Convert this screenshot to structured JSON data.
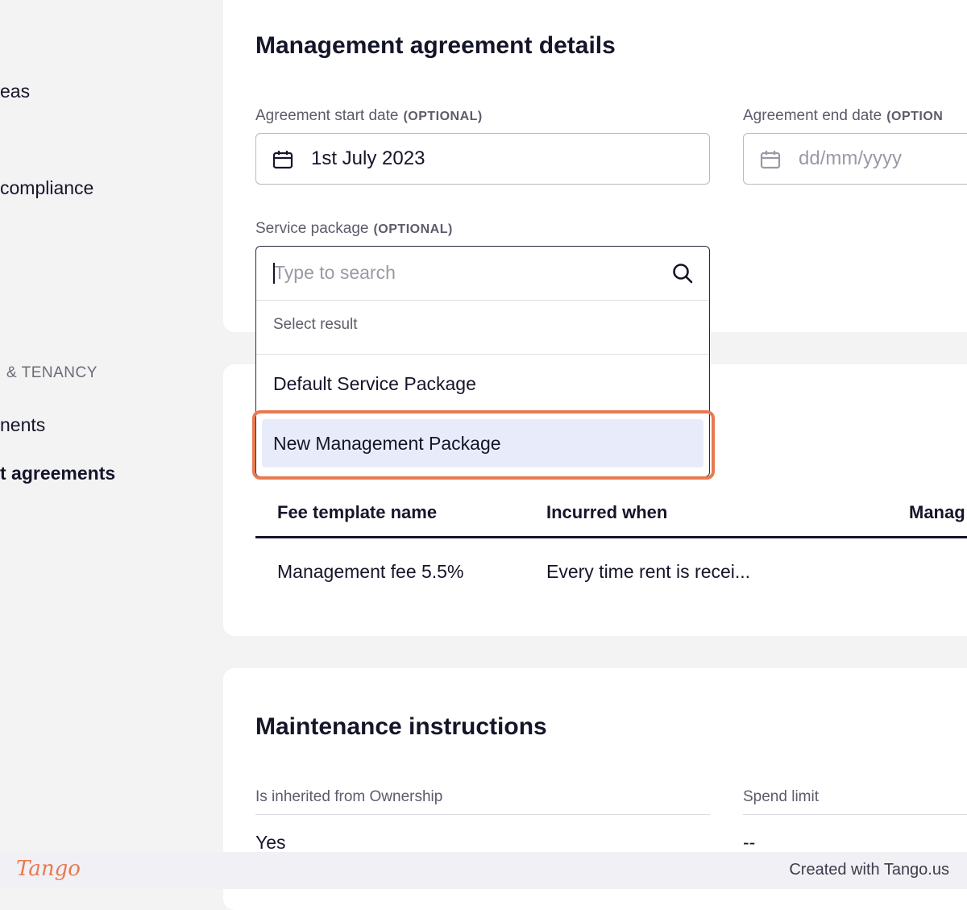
{
  "sidebar": {
    "items": [
      {
        "label": "eas"
      },
      {
        "label": "compliance"
      },
      {
        "label": "nents"
      },
      {
        "label": "t agreements"
      }
    ],
    "section_label": "& TENANCY"
  },
  "management_card": {
    "title": "Management agreement details",
    "start_date": {
      "label": "Agreement start date",
      "optional": "(OPTIONAL)",
      "value": "1st July 2023"
    },
    "end_date": {
      "label": "Agreement end date",
      "optional": "(OPTION",
      "placeholder": "dd/mm/yyyy"
    },
    "service_package": {
      "label": "Service package",
      "optional": "(OPTIONAL)"
    }
  },
  "dropdown": {
    "search_placeholder": "Type to search",
    "hint": "Select result",
    "options": [
      {
        "label": "Default Service Package"
      },
      {
        "label": "New Management Package"
      }
    ]
  },
  "fees_table": {
    "headers": [
      "Fee template name",
      "Incurred when",
      "Manag"
    ],
    "rows": [
      [
        "Management fee 5.5%",
        "Every time rent is recei..."
      ]
    ]
  },
  "maintenance": {
    "title": "Maintenance instructions",
    "fields": [
      {
        "label": "Is inherited from Ownership",
        "value": "Yes"
      },
      {
        "label": "Spend limit",
        "value": "--"
      }
    ]
  },
  "footer": {
    "logo": "Tango",
    "credit": "Created with Tango.us"
  },
  "colors": {
    "highlight": "#e87a50",
    "selected_option_bg": "#e8ecfa",
    "text": "#15152a"
  }
}
